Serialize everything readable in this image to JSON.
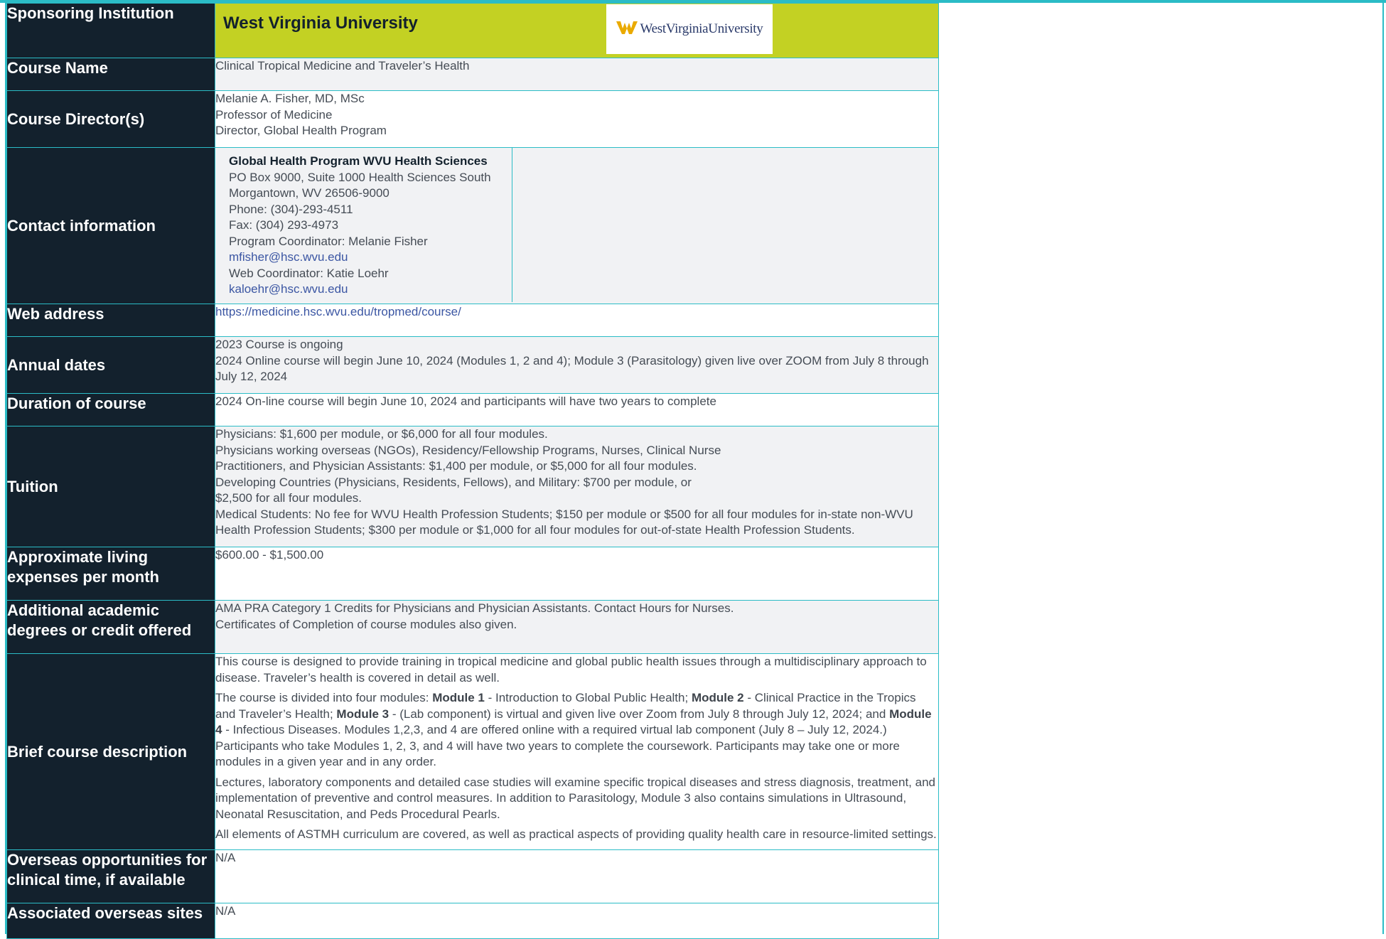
{
  "rows": {
    "sponsoring": {
      "label": "Sponsoring Institution",
      "value": "West Virginia University",
      "logo_text": "WestVirginiaUniversity"
    },
    "course_name": {
      "label": "Course Name",
      "value": "Clinical Tropical Medicine and Traveler’s Health"
    },
    "director": {
      "label": "Course Director(s)",
      "lines": [
        "Melanie A. Fisher, MD, MSc",
        "Professor of Medicine",
        "Director, Global Health Program"
      ]
    },
    "contact": {
      "label": "Contact information",
      "org": "Global Health Program WVU Health Sciences",
      "lines": [
        "PO Box 9000, Suite 1000 Health Sciences South",
        "Morgantown, WV 26506-9000",
        "Phone: (304)-293-4511",
        "Fax: (304) 293-4973",
        "Program Coordinator: Melanie Fisher"
      ],
      "email1": "mfisher@hsc.wvu.edu",
      "web_coord": "Web Coordinator: Katie Loehr",
      "email2": "kaloehr@hsc.wvu.edu"
    },
    "web": {
      "label": "Web address",
      "value": "https://medicine.hsc.wvu.edu/tropmed/course/"
    },
    "dates": {
      "label": "Annual dates",
      "line1": "2023 Course is ongoing",
      "line2": "2024 Online course will begin June 10, 2024 (Modules 1, 2 and 4); Module 3 (Parasitology) given live over ZOOM from July 8 through July 12, 2024"
    },
    "duration": {
      "label": "Duration of course",
      "value": "2024 On-line course will begin June 10, 2024 and participants will have two years to complete"
    },
    "tuition": {
      "label": "Tuition",
      "lines": [
        "Physicians: $1,600 per module, or $6,000 for all four modules.",
        "Physicians working overseas (NGOs), Residency/Fellowship Programs, Nurses, Clinical Nurse",
        "Practitioners, and Physician Assistants: $1,400 per module, or $5,000 for all four modules.",
        "Developing Countries (Physicians, Residents, Fellows), and Military: $700 per module, or",
        "$2,500 for all four modules."
      ],
      "last": "Medical Students: No fee for WVU Health Profession Students; $150 per module or $500 for all four modules for in-state non-WVU Health Profession Students; $300 per module or $1,000 for all four modules for out-of-state Health Profession Students."
    },
    "living": {
      "label": "Approximate living expenses per month",
      "value": "$600.00 - $1,500.00"
    },
    "credit": {
      "label": "Additional academic degrees or credit offered",
      "line1": "AMA PRA Category 1 Credits for Physicians and Physician Assistants. Contact Hours for Nurses.",
      "line2": "Certificates of Completion of course modules also given."
    },
    "description": {
      "label": "Brief course description",
      "p1": "This course is designed to provide training in tropical medicine and global public health issues through a multidisciplinary approach to disease. Traveler’s health is covered in detail as well.",
      "p2_a": "The course is divided into four modules: ",
      "m1": "Module 1",
      "p2_b": " - Introduction to Global Public Health; ",
      "m2": "Module 2",
      "p2_c": " - Clinical Practice in the Tropics and Traveler’s Health; ",
      "m3": "Module 3",
      "p2_d": " - (Lab component) is virtual and given live over Zoom from July 8 through July 12, 2024; and ",
      "m4": "Module 4",
      "p2_e": " - Infectious Diseases. Modules 1,2,3, and 4 are offered online with a required virtual lab component (July 8 – July 12, 2024.) Participants who take Modules 1, 2, 3, and 4 will have two years to complete the coursework. Participants may take one or more modules in a given year and in any order.",
      "p3": "Lectures, laboratory components and detailed case studies will examine specific tropical diseases and stress diagnosis, treatment, and implementation of preventive and control measures. In addition to Parasitology, Module 3 also contains simulations in Ultrasound, Neonatal Resuscitation, and Peds Procedural Pearls.",
      "p4": "All elements of ASTMH curriculum are covered, as well as practical aspects of providing quality health care in resource-limited settings."
    },
    "overseas": {
      "label": "Overseas opportunities for clinical time, if available",
      "value": "N/A"
    },
    "sites": {
      "label": "Associated overseas sites",
      "value": "N/A"
    }
  },
  "colors": {
    "label_bg": "#13212d",
    "accent_teal": "#2bbcc6",
    "header_lime": "#c3d123",
    "link": "#3b56a3"
  }
}
